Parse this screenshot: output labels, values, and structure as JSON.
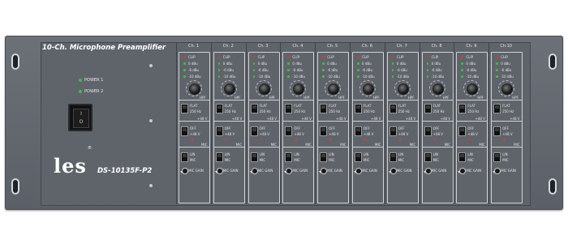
{
  "device": {
    "title": "10-Ch. Microphone Preamplifier",
    "model": "DS-10135F-P2",
    "brand": "les",
    "brand_mark": "®",
    "power_labels": [
      "POWER 1",
      "POWER 2"
    ],
    "switch_on": "I",
    "switch_off": "O"
  },
  "channels": [
    {
      "name": "Ch. 1"
    },
    {
      "name": "Ch. 2"
    },
    {
      "name": "Ch. 3"
    },
    {
      "name": "Ch. 4"
    },
    {
      "name": "Ch. 5"
    },
    {
      "name": "Ch. 6"
    },
    {
      "name": "Ch. 7"
    },
    {
      "name": "Ch. 8"
    },
    {
      "name": "Ch. 9"
    },
    {
      "name": "Ch.10"
    }
  ],
  "channel_labels": {
    "clip": "CLIP",
    "levels": [
      "0 dBu",
      "-6 dBu",
      "-10 dBu"
    ],
    "hpf": "HPF",
    "flat": "FLAT",
    "freq": "250 Hz",
    "off": "OFF",
    "phantom": "+48 V",
    "lin": "LIN",
    "mic": "MIC",
    "mic_gain": "MIC GAIN"
  },
  "colors": {
    "panel": "#5f646b",
    "led_green": "#3fbf3f",
    "led_red": "#d23b3b"
  }
}
